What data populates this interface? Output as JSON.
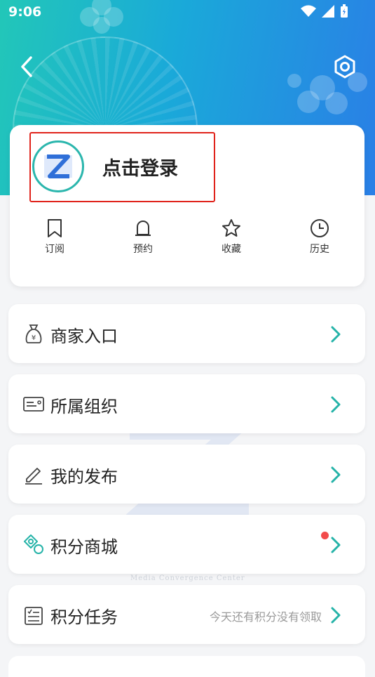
{
  "status_bar": {
    "time": "9:06"
  },
  "profile": {
    "login_prompt": "点击登录"
  },
  "quick_actions": [
    {
      "label": "订阅",
      "icon": "bookmark-icon"
    },
    {
      "label": "预约",
      "icon": "bell-icon"
    },
    {
      "label": "收藏",
      "icon": "star-icon"
    },
    {
      "label": "历史",
      "icon": "clock-icon"
    }
  ],
  "menu": [
    {
      "label": "商家入口",
      "icon": "money-bag-icon"
    },
    {
      "label": "所属组织",
      "icon": "id-card-icon"
    },
    {
      "label": "我的发布",
      "icon": "edit-icon"
    },
    {
      "label": "积分商城",
      "icon": "coins-icon",
      "badge": "red-dot"
    },
    {
      "label": "积分任务",
      "icon": "task-list-icon",
      "extra": "今天还有积分没有领取"
    }
  ],
  "watermark": {
    "text": "Media Convergence Center"
  },
  "colors": {
    "accent": "#2bb6ad",
    "header_start": "#22c7b8",
    "header_end": "#2a7fe6",
    "highlight_border": "#e0231b",
    "badge": "#f24b4b"
  }
}
